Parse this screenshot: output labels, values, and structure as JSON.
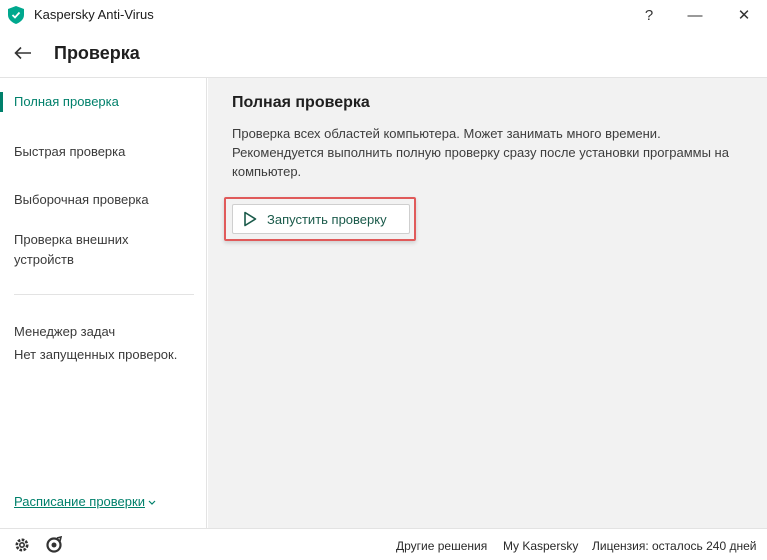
{
  "window": {
    "title": "Kaspersky Anti-Virus",
    "help": "?",
    "minimize": "—",
    "close": "✕"
  },
  "header": {
    "title": "Проверка"
  },
  "sidebar": {
    "items": [
      {
        "label": "Полная проверка",
        "active": true
      },
      {
        "label": "Быстрая проверка",
        "active": false
      },
      {
        "label": "Выборочная проверка",
        "active": false
      },
      {
        "label": "Проверка внешних устройств",
        "active": false
      }
    ],
    "task_manager": {
      "title": "Менеджер задач",
      "status": "Нет запущенных проверок."
    },
    "schedule_link": "Расписание проверки"
  },
  "main": {
    "heading": "Полная проверка",
    "description": "Проверка всех областей компьютера. Может занимать много времени. Рекомендуется выполнить полную проверку сразу после установки программы на компьютер.",
    "run_button": "Запустить проверку"
  },
  "footer": {
    "links": [
      "Другие решения",
      "My Kaspersky",
      "Лицензия: осталось 240 дней"
    ]
  },
  "colors": {
    "accent": "#00806b",
    "highlight": "#e05a5a",
    "content_bg": "#f2f2f2"
  },
  "icons": [
    "kaspersky-shield-icon",
    "back-arrow-icon",
    "play-icon",
    "gear-icon",
    "support-icon",
    "chevron-down-icon"
  ]
}
